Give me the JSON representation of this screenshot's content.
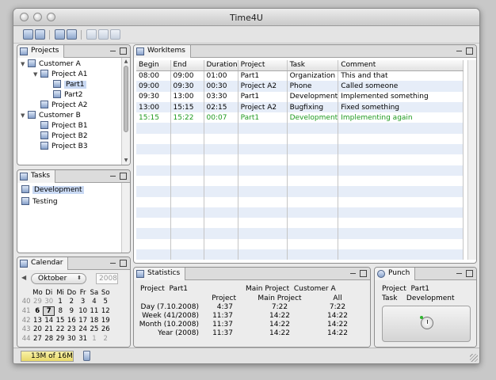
{
  "window": {
    "title": "Time4U"
  },
  "projects": {
    "tab": "Projects",
    "tree": [
      {
        "label": "Customer A",
        "twisty": "▼"
      },
      {
        "label": "Project A1",
        "twisty": "▼"
      },
      {
        "label": "Part1",
        "twisty": ""
      },
      {
        "label": "Part2",
        "twisty": ""
      },
      {
        "label": "Project A2",
        "twisty": ""
      },
      {
        "label": "Customer B",
        "twisty": "▼"
      },
      {
        "label": "Project B1",
        "twisty": ""
      },
      {
        "label": "Project B2",
        "twisty": ""
      },
      {
        "label": "Project B3",
        "twisty": ""
      }
    ]
  },
  "tasks": {
    "tab": "Tasks",
    "items": [
      "Development",
      "Testing"
    ]
  },
  "workitems": {
    "tab": "WorkItems",
    "columns": [
      "Begin",
      "End",
      "Duration",
      "Project",
      "Task",
      "Comment"
    ],
    "rows": [
      [
        "08:00",
        "09:00",
        "01:00",
        "Part1",
        "Organization",
        "This and that"
      ],
      [
        "09:00",
        "09:30",
        "00:30",
        "Project A2",
        "Phone",
        "Called someone"
      ],
      [
        "09:30",
        "13:00",
        "03:30",
        "Part1",
        "Development",
        "Implemented something"
      ],
      [
        "13:00",
        "15:15",
        "02:15",
        "Project A2",
        "Bugfixing",
        "Fixed something"
      ],
      [
        "15:15",
        "15:22",
        "00:07",
        "Part1",
        "Development",
        "Implementing again"
      ]
    ]
  },
  "calendar": {
    "tab": "Calendar",
    "month": "Oktober",
    "year": "2008",
    "weekday_headers": [
      "Mo",
      "Di",
      "Mi",
      "Do",
      "Fr",
      "Sa",
      "So"
    ],
    "weeks": [
      {
        "wk": "40",
        "days": [
          "29",
          "30",
          "1",
          "2",
          "3",
          "4",
          "5"
        ]
      },
      {
        "wk": "41",
        "days": [
          "6",
          "7",
          "8",
          "9",
          "10",
          "11",
          "12"
        ]
      },
      {
        "wk": "42",
        "days": [
          "13",
          "14",
          "15",
          "16",
          "17",
          "18",
          "19"
        ]
      },
      {
        "wk": "43",
        "days": [
          "20",
          "21",
          "22",
          "23",
          "24",
          "25",
          "26"
        ]
      },
      {
        "wk": "44",
        "days": [
          "27",
          "28",
          "29",
          "30",
          "31",
          "1",
          "2"
        ]
      }
    ]
  },
  "statistics": {
    "tab": "Statistics",
    "project_label": "Project",
    "project_value": "Part1",
    "main_project_label": "Main Project",
    "main_project_value": "Customer A",
    "col_headers": [
      "Project",
      "Main Project",
      "All"
    ],
    "rows": [
      {
        "label": "Day (7.10.2008)",
        "values": [
          "4:37",
          "7:22",
          "7:22"
        ]
      },
      {
        "label": "Week (41/2008)",
        "values": [
          "11:37",
          "14:22",
          "14:22"
        ]
      },
      {
        "label": "Month (10.2008)",
        "values": [
          "11:37",
          "14:22",
          "14:22"
        ]
      },
      {
        "label": "Year (2008)",
        "values": [
          "11:37",
          "14:22",
          "14:22"
        ]
      }
    ]
  },
  "punch": {
    "tab": "Punch",
    "project_label": "Project",
    "project_value": "Part1",
    "task_label": "Task",
    "task_value": "Development"
  },
  "status": {
    "memory": "13M of 16M"
  }
}
